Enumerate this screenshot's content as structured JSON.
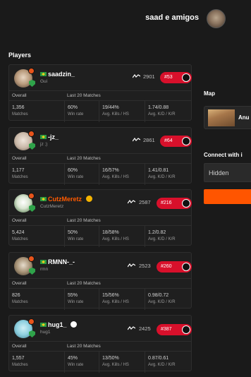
{
  "team": {
    "name": "saad e amigos",
    "avatar_icon": "cat-avatar"
  },
  "players_title": "Players",
  "stat_headers": {
    "overall": "Overall",
    "last20": "Last 20 Matches"
  },
  "stat_labels": {
    "matches": "Matches",
    "winrate": "Win rate",
    "kills_hs": "Avg. Kills / HS",
    "kd_kr": "Avg. K/D / K/R"
  },
  "players": [
    {
      "nick": "saadzin_",
      "sub": "Gui",
      "elo": "2901",
      "rank": "#53",
      "matches": "1,356",
      "winrate": "60%",
      "kills_hs": "19/44%",
      "kd_kr": "1.74/0.88",
      "premium": false,
      "verified": false
    },
    {
      "nick": "-jz_",
      "sub": "jz ;)",
      "elo": "2861",
      "rank": "#64",
      "matches": "1,177",
      "winrate": "60%",
      "kills_hs": "16/57%",
      "kd_kr": "1.41/0.81",
      "premium": false,
      "verified": false
    },
    {
      "nick": "CutzMeretz",
      "sub": "CutzMeretz",
      "elo": "2587",
      "rank": "#216",
      "matches": "5,424",
      "winrate": "50%",
      "kills_hs": "18/58%",
      "kd_kr": "1.2/0.82",
      "premium": true,
      "verified": true
    },
    {
      "nick": "RMNN-_-",
      "sub": "rmn",
      "elo": "2523",
      "rank": "#260",
      "matches": "826",
      "winrate": "55%",
      "kills_hs": "15/56%",
      "kd_kr": "0.98/0.72",
      "premium": false,
      "verified": false
    },
    {
      "nick": "hug1_",
      "sub": "hug1",
      "elo": "2425",
      "rank": "#387",
      "matches": "1,557",
      "winrate": "45%",
      "kills_hs": "13/50%",
      "kd_kr": "0.87/0.61",
      "premium": false,
      "verified": true
    }
  ],
  "map": {
    "title": "Map",
    "name": "Anu"
  },
  "connect": {
    "title": "Connect with i",
    "ip_value": "Hidden",
    "button_label": ""
  },
  "colors": {
    "accent": "#ff5500",
    "rank_pill": "#d8102b",
    "premium_name": "#ff5a00",
    "shield": "#2fa34a"
  }
}
